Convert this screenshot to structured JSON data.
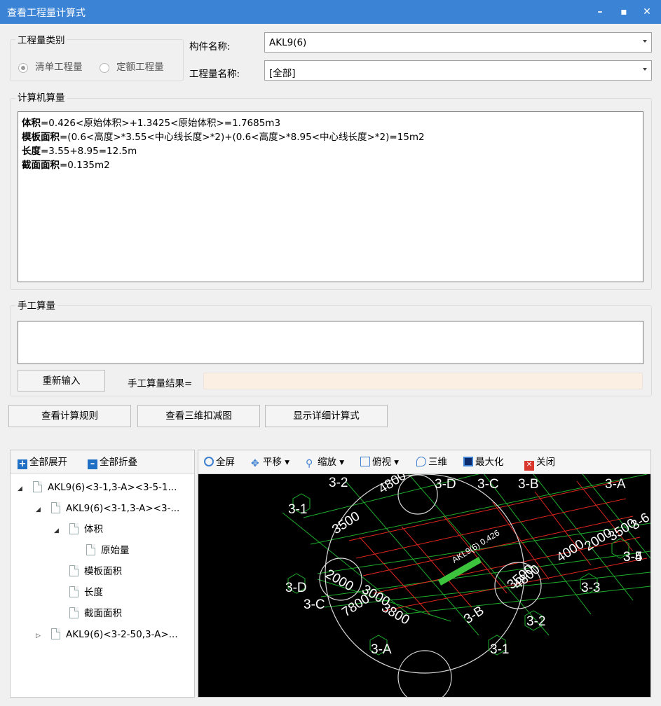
{
  "window": {
    "title": "查看工程量计算式"
  },
  "category": {
    "group_title": "工程量类别",
    "options": [
      {
        "label": "清单工程量",
        "checked": true
      },
      {
        "label": "定额工程量",
        "checked": false
      }
    ]
  },
  "component": {
    "label": "构件名称:",
    "value": "AKL9(6)"
  },
  "quantity_name": {
    "label": "工程量名称:",
    "value": "[全部]"
  },
  "computer_calc": {
    "group_title": "计算机算量",
    "lines": [
      {
        "name": "体积",
        "expr": "=0.426<原始体积>+1.3425<原始体积>=1.7685m3"
      },
      {
        "name": "模板面积",
        "expr": "=(0.6<高度>*3.55<中心线长度>*2)+(0.6<高度>*8.95<中心线长度>*2)=15m2"
      },
      {
        "name": "长度",
        "expr": "=3.55+8.95=12.5m"
      },
      {
        "name": "截面面积",
        "expr": "=0.135m2"
      }
    ]
  },
  "manual_calc": {
    "group_title": "手工算量",
    "reinput_button": "重新输入",
    "result_label": "手工算量结果=",
    "result_value": ""
  },
  "actions": {
    "view_rules": "查看计算规则",
    "view_3d": "查看三维扣减图",
    "show_detail": "显示详细计算式"
  },
  "tree_toolbar": {
    "expand_all": "全部展开",
    "collapse_all": "全部折叠"
  },
  "tree": [
    {
      "label": "AKL9(6)<3-1,3-A><3-5-1...",
      "level": 0,
      "toggle": "◢"
    },
    {
      "label": "AKL9(6)<3-1,3-A><3-...",
      "level": 1,
      "toggle": "◢"
    },
    {
      "label": "体积",
      "level": 2,
      "toggle": "◢"
    },
    {
      "label": "原始量",
      "level": 3,
      "toggle": ""
    },
    {
      "label": "模板面积",
      "level": 2,
      "toggle": ""
    },
    {
      "label": "长度",
      "level": 2,
      "toggle": ""
    },
    {
      "label": "截面面积",
      "level": 2,
      "toggle": ""
    },
    {
      "label": "AKL9(6)<3-2-50,3-A>...",
      "level": 1,
      "toggle": "▷"
    }
  ],
  "view_toolbar": {
    "fullscreen": "全屏",
    "pan": "平移",
    "zoom": "缩放",
    "topview": "俯视",
    "threed": "三维",
    "maximize": "最大化",
    "close": "关闭"
  },
  "viewport": {
    "grid_labels": [
      "3-2",
      "4800",
      "3-D",
      "3-C",
      "3-B",
      "3-A",
      "3-1",
      "3500",
      "4000",
      "2000",
      "3500",
      "3-6",
      "3-5",
      "3-4",
      "3-D",
      "2000",
      "3000",
      "3800",
      "3-C",
      "7800",
      "3-B",
      "3500",
      "4800",
      "3-3",
      "3-2",
      "3-A",
      "3-1"
    ],
    "beam_label": "AKL9(6) 0.426"
  }
}
